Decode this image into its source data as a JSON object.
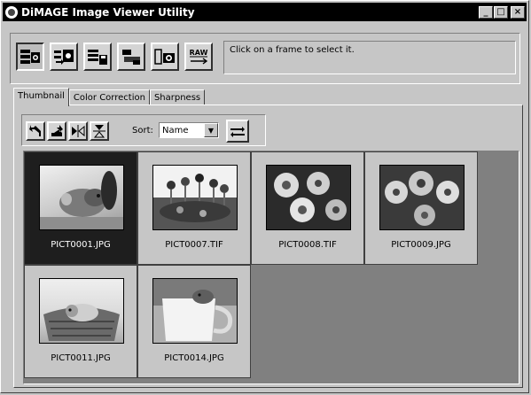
{
  "window": {
    "title": "DiMAGE Image Viewer Utility",
    "controls": [
      "_",
      "□",
      "×"
    ]
  },
  "toolbar": {
    "buttons": [
      {
        "name": "view-thumbnail-button",
        "icon": "camera-thumbnail-icon"
      },
      {
        "name": "camera-to-folder-button",
        "icon": "camera-transfer-icon"
      },
      {
        "name": "save-button",
        "icon": "save-images-icon"
      },
      {
        "name": "print-button",
        "icon": "printer-icon"
      },
      {
        "name": "camera-settings-button",
        "icon": "camera-icon"
      },
      {
        "name": "raw-button",
        "icon": "raw-icon",
        "label": "RAW"
      }
    ],
    "status_text": "Click on a frame to select it."
  },
  "tabs": [
    {
      "label": "Thumbnail",
      "active": true
    },
    {
      "label": "Color Correction",
      "active": false
    },
    {
      "label": "Sharpness",
      "active": false
    }
  ],
  "thumb_toolbar": {
    "sort_label": "Sort:",
    "sort_value": "Name",
    "buttons": [
      "rotate-left-icon",
      "rotate-right-icon",
      "flip-horizontal-icon",
      "flip-vertical-icon"
    ],
    "swap_icon": "sort-order-icon"
  },
  "thumbnails": [
    {
      "filename": "PICT0001.JPG",
      "selected": true,
      "subject": "hamster"
    },
    {
      "filename": "PICT0007.TIF",
      "selected": false,
      "subject": "flowers"
    },
    {
      "filename": "PICT0008.TIF",
      "selected": false,
      "subject": "pansies"
    },
    {
      "filename": "PICT0009.JPG",
      "selected": false,
      "subject": "pansies"
    },
    {
      "filename": "PICT0011.JPG",
      "selected": false,
      "subject": "hamster-basket"
    },
    {
      "filename": "PICT0014.JPG",
      "selected": false,
      "subject": "hamster-cup"
    }
  ]
}
